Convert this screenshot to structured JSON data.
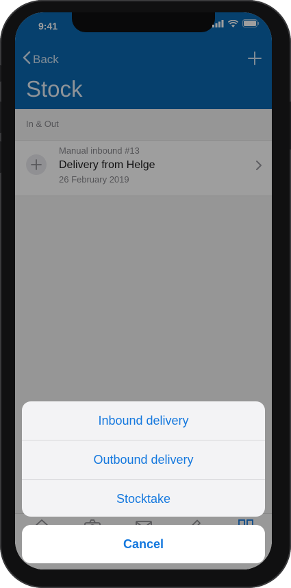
{
  "status_bar": {
    "time": "9:41",
    "icons": [
      "cellular-signal-icon",
      "wifi-icon",
      "battery-icon"
    ]
  },
  "nav": {
    "back_label": "Back",
    "add_icon": "plus-icon",
    "title": "Stock"
  },
  "section": {
    "label": "In & Out"
  },
  "list": {
    "items": [
      {
        "subtitle": "Manual inbound #13",
        "title": "Delivery from Helge",
        "date": "26 February 2019",
        "icon": "plus-icon",
        "accessory": "chevron-right-icon"
      }
    ]
  },
  "tabbar": {
    "icons": [
      "home-icon",
      "camera-icon",
      "mail-icon",
      "edit-icon",
      "grid-icon"
    ]
  },
  "action_sheet": {
    "options": [
      "Inbound delivery",
      "Outbound delivery",
      "Stocktake"
    ],
    "cancel": "Cancel"
  },
  "colors": {
    "header": "#0a68b0",
    "accent": "#1478de",
    "dim_overlay": "rgba(0,0,0,0.38)"
  }
}
